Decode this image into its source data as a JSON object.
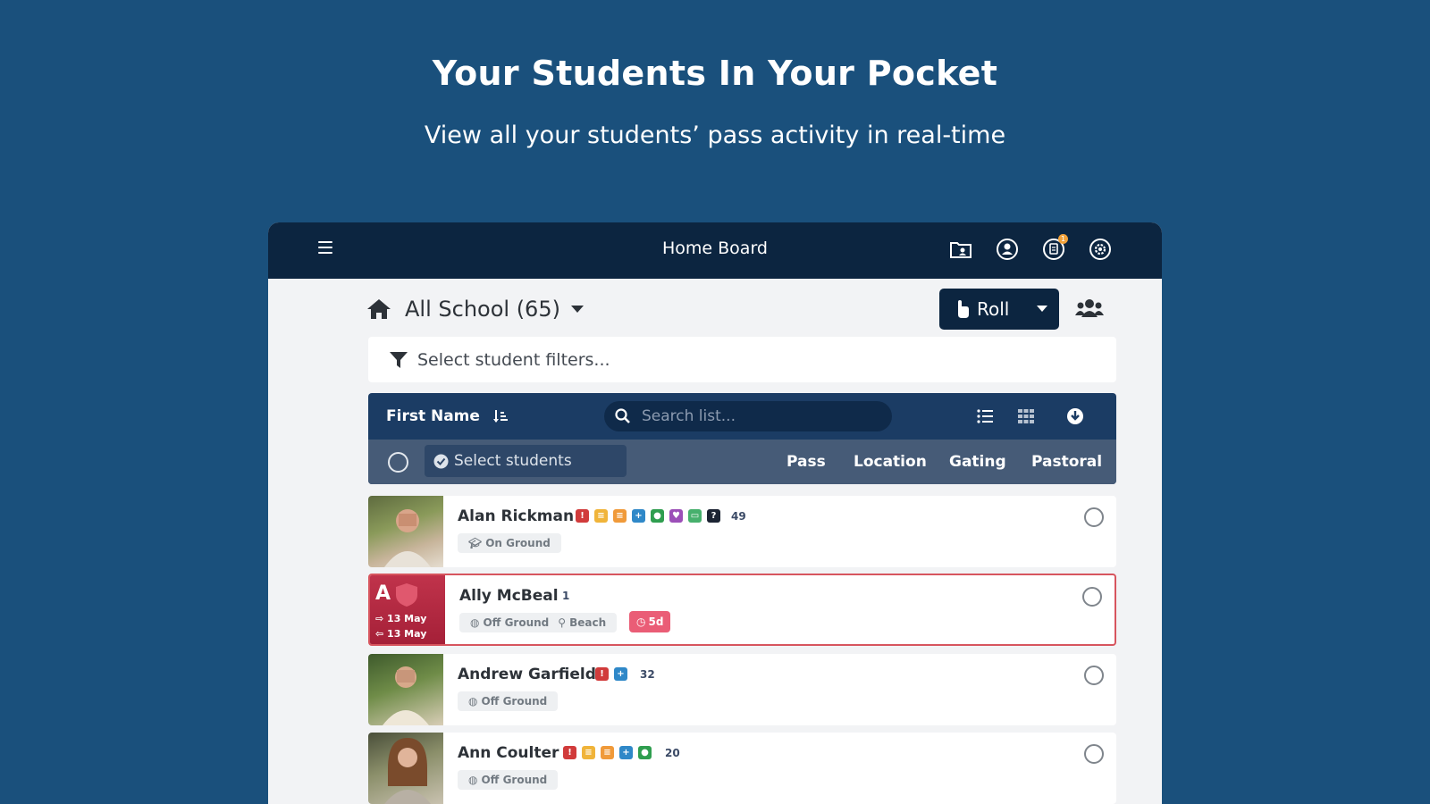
{
  "hero": {
    "title": "Your Students In Your Pocket",
    "subtitle": "View all your students’ pass activity in real-time"
  },
  "topbar": {
    "title": "Home Board",
    "notification_count": "1"
  },
  "toolbar": {
    "school_label": "All School (65)",
    "roll_label": "Roll",
    "filter_placeholder": "Select student filters..."
  },
  "list_header": {
    "sort_label": "First Name",
    "search_placeholder": "Search list...",
    "select_students": "Select students",
    "columns": [
      "Pass",
      "Location",
      "Gating",
      "Pastoral"
    ]
  },
  "students": [
    {
      "name": "Alan Rickman",
      "count": "49",
      "status": "On Ground"
    },
    {
      "name": "Ally McBeal",
      "count": "1",
      "status": "Off Ground",
      "location": "Beach",
      "ago": "5d",
      "initial": "A",
      "out_date": "13 May",
      "in_date": "13 May"
    },
    {
      "name": "Andrew Garfield",
      "count": "32",
      "status": "Off Ground"
    },
    {
      "name": "Ann Coulter",
      "count": "20",
      "status": "Off Ground"
    }
  ],
  "colors": {
    "background": "#1a507c",
    "nav": "#0c2540",
    "header": "#1b3c64",
    "subheader": "#465b77",
    "alert": "#d7555e",
    "badge": "#ea5d76"
  }
}
